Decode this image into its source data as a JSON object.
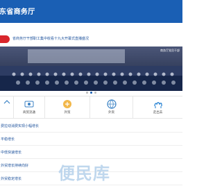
{
  "header": {
    "title": "东省商务厅"
  },
  "ticker": {
    "text": "省商务厅干部职工集中收看十九大开幕式直播盛况"
  },
  "carousel": {
    "caption": "商务厅党员干部",
    "active_index": 1,
    "total": 3
  },
  "grid": [
    {
      "label": "",
      "icon": "partial-icon"
    },
    {
      "label": "商贸流通",
      "icon": "commerce-icon"
    },
    {
      "label": "外贸",
      "icon": "foreign-trade-icon"
    },
    {
      "label": "外资",
      "icon": "foreign-investment-icon"
    },
    {
      "label": "走出去",
      "icon": "camel-icon"
    }
  ],
  "list": [
    "费拉动消费实现小幅增长",
    "平稳增长",
    "中低快速增长",
    "外贸增长持续向好",
    "外贸稳定增长"
  ],
  "watermark": "便民库"
}
